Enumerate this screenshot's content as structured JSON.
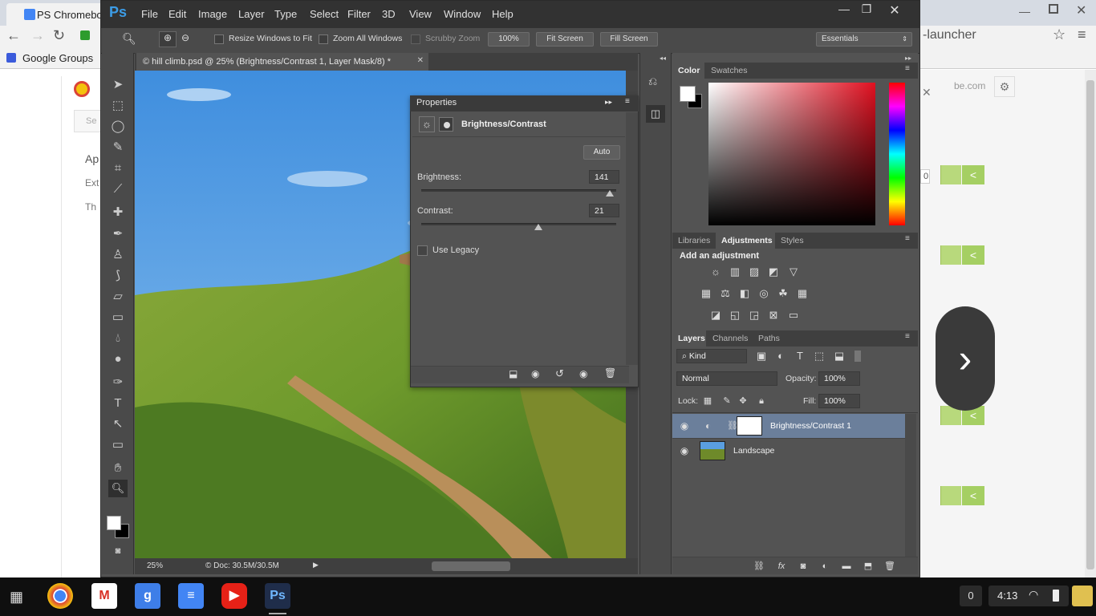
{
  "chrome": {
    "tab_title": "PS Chromebook",
    "address_tail": "-launcher",
    "bookmark": "Google Groups",
    "page_left_items": [
      "Ap",
      "Ext",
      "Th"
    ],
    "page_search_placeholder": "Se",
    "right_domain": "be.com",
    "right_counter": "0"
  },
  "ps": {
    "menus": [
      "File",
      "Edit",
      "Image",
      "Layer",
      "Type",
      "Select",
      "Filter",
      "3D",
      "View",
      "Window",
      "Help"
    ],
    "options": {
      "resize_windows": "Resize Windows to Fit",
      "zoom_all": "Zoom All Windows",
      "scrubby": "Scrubby Zoom",
      "zoom_value": "100%",
      "fit_screen": "Fit Screen",
      "fill_screen": "Fill Screen",
      "workspace": "Essentials"
    },
    "document": {
      "tab_title": "© hill climb.psd @ 25% (Brightness/Contrast 1, Layer Mask/8) *",
      "zoom": "25%",
      "doc_size": "Doc: 30.5M/30.5M"
    },
    "properties": {
      "title": "Properties",
      "adjustment": "Brightness/Contrast",
      "auto": "Auto",
      "brightness_label": "Brightness:",
      "brightness_value": "141",
      "brightness_fraction": 0.966,
      "contrast_label": "Contrast:",
      "contrast_value": "21",
      "contrast_fraction": 0.6,
      "use_legacy": "Use Legacy"
    },
    "color_panel": {
      "tabs": [
        "Color",
        "Swatches"
      ],
      "hue_color": "#e01020"
    },
    "adjustments_panel": {
      "tabs": [
        "Libraries",
        "Adjustments",
        "Styles"
      ],
      "heading": "Add an adjustment"
    },
    "layers_panel": {
      "tabs": [
        "Layers",
        "Channels",
        "Paths"
      ],
      "filter": "Kind",
      "blend_mode": "Normal",
      "opacity_label": "Opacity:",
      "opacity": "100%",
      "lock_label": "Lock:",
      "fill_label": "Fill:",
      "fill": "100%",
      "layers": [
        {
          "name": "Brightness/Contrast 1",
          "selected": true
        },
        {
          "name": "Landscape",
          "selected": false
        }
      ]
    }
  },
  "taskbar": {
    "notifications": "0",
    "time": "4:13"
  }
}
